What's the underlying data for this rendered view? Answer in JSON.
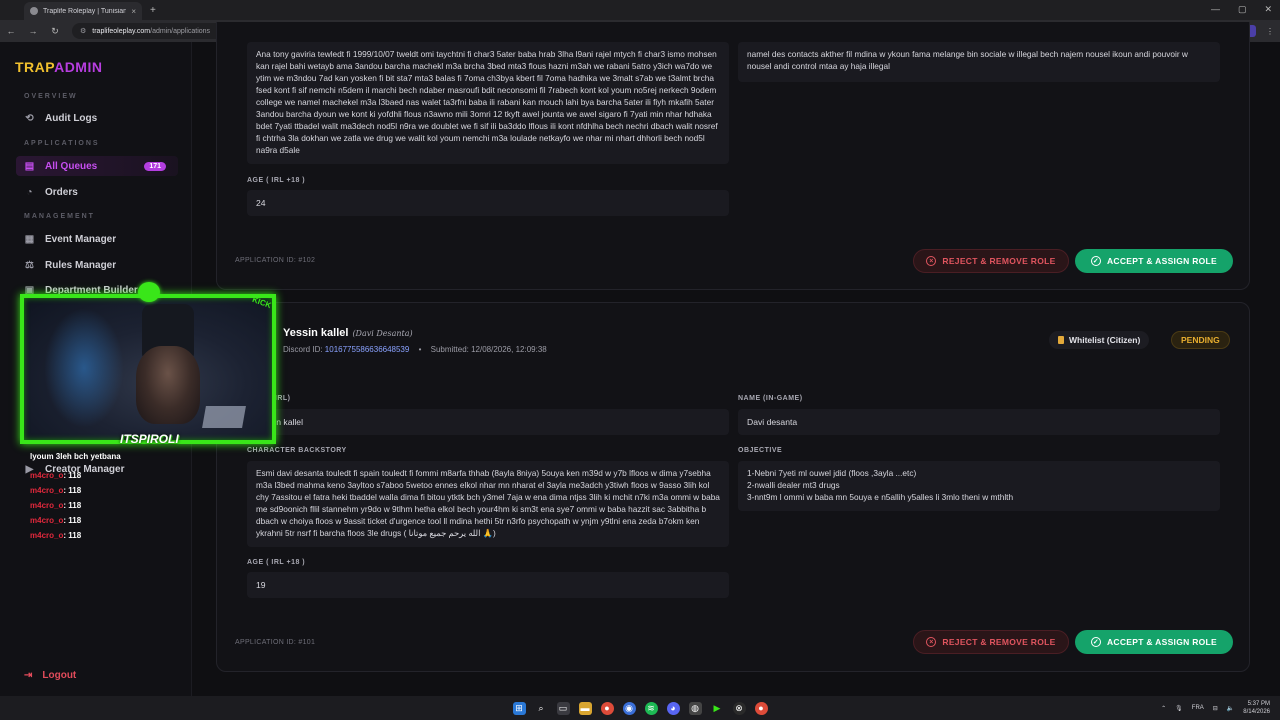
{
  "browser": {
    "tab_title": "Traplife Roleplay | Tunisian GTA",
    "url_host": "traplifeoleplay.com",
    "url_path": "/admin/applications",
    "new_tab": "+",
    "close": "×"
  },
  "sidebar": {
    "brand_1": "TRAP",
    "brand_2": "ADMIN",
    "sections": [
      "OVERVIEW",
      "APPLICATIONS",
      "MANAGEMENT"
    ],
    "items": [
      {
        "label": "Audit Logs",
        "icon": "history-icon"
      },
      {
        "label": "All Queues",
        "icon": "document-icon",
        "badge": "171"
      },
      {
        "label": "Orders",
        "icon": "tag-icon"
      },
      {
        "label": "Event Manager",
        "icon": "calendar-icon"
      },
      {
        "label": "Rules Manager",
        "icon": "scale-icon"
      },
      {
        "label": "Department Builder",
        "icon": "grid-icon"
      },
      {
        "label": "Creator Manager",
        "icon": "video-icon"
      }
    ],
    "logout": "Logout"
  },
  "overlay": {
    "streamer_tag": "ITSPIROLI",
    "kick": "KICK",
    "chat_first": "lyoum 3leh bch yetbana",
    "chat": [
      {
        "user": "m4cro_o",
        "msg": ": 118"
      },
      {
        "user": "m4cro_o",
        "msg": ": 118"
      },
      {
        "user": "m4cro_o",
        "msg": ": 118"
      },
      {
        "user": "m4cro_o",
        "msg": ": 118"
      },
      {
        "user": "m4cro_o",
        "msg": ": 118"
      }
    ]
  },
  "app1": {
    "backstory": "Ana tony gaviria tewledt fi 1999/10/07 tweldt omi taychtni fi char3 5ater baba hrab 3lha l9ani rajel mtych fi char3 ismo mohsen kan rajel bahi wetayb ama 3andou barcha machekl m3a brcha 3bed mta3 flous hazni m3ah we rabani 5atro y3ich wa7do we ytim we m3ndou 7ad kan yosken fi bit sta7 mta3 balas fi 7oma ch3bya kbert fil 7oma hadhika we 3malt s7ab we t3almt brcha fsed kont fi sif nemchi n5dem il marchi bech ndaber masroufi bdit neconsomi fil 7rabech kont kol youm no5rej nerkech 9odem college we namel machekel m3a l3baed nas walet ta3rfni baba ili rabani kan mouch lahi bya barcha 5ater ili fiyh mkafih 5ater 3andou barcha dyoun we kont ki yofdhli flous n3awno mili 3omri 12 tkyft awel jounta we awel sigaro fi 7yati min nhar hdhaka bdet 7yati ttbadel walit ma3dech nod5l n9ra we doublet we fi sif ili ba3ddo lflous ili kont nfdhlha bech nechri dbach walit nosref fi chtrha 3la dokhan we zatla we drug we walit kol youm nemchi m3a loulade netkayfo we nhar mi nhart dhhorli bech nod5l na9ra d5ale",
    "objective": "namel des contacts akther fil mdina w ykoun fama melange bin sociale w illegal bech najem nousel  ikoun andi pouvoir w  nousel andi control mtaa ay haja illegal",
    "age_label": "AGE ( IRL +18 )",
    "age": "24",
    "app_id": "APPLICATION ID: #102",
    "reject": "REJECT & REMOVE ROLE",
    "accept": "ACCEPT & ASSIGN ROLE"
  },
  "app2": {
    "name": "Yessin kallel",
    "rp_name": "(Davi Desanta)",
    "discord_label": "Discord ID: ",
    "discord_id": "1016775586636648539",
    "dot": "•",
    "submitted": "Submitted: 12/08/2026, 12:09:38",
    "type_tag": "Whitelist (Citizen)",
    "status": "PENDING",
    "name_irl_label": "NAME (IRL)",
    "name_irl": "Yessin kallel",
    "name_game_label": "NAME (IN-GAME)",
    "name_game": "Davi desanta",
    "backstory_label": "CHARACTER BACKSTORY",
    "backstory": "Esmi davi desanta touledt fi spain touledt fi fommi m8arfa thhab (8ayla 8niya) 5ouya ken m39d w y7b lfloos w dima y7sebha m3a l3bed mahma keno 3ayltoo s7aboo 5wetoo ennes elkol nhar mn nharat el 3ayla me3adch y3tiwh floos w 9asso 3lih kol chy 7assitou el fatra heki tbaddel walla dima fi bitou ytktk bch y3mel 7aja w ena dima ntjss 3lih ki mchit n7ki m3a ommi w baba me sd9oonich fllil  stannehm yr9do w 9tlhm hetha elkol bech your4hm ki sm3t ena sye7 ommi w baba hazzit sac 3abbitha b dbach w choiya floos  w 9assit ticket d'urgence tool ll mdina hethi 5tr n3rfo psychopath w ynjm y9tlni ena zeda b7okm ken ykrahni 5tr nsrf fi barcha floos 3le drugs  ( الله يرحم جميع موتانا 🙏)",
    "objective_label": "OBJECTIVE",
    "objective_lines": [
      "1-Nebni 7yeti ml ouwel jdid (floos ,3ayla ...etc)",
      "2-nwalli dealer mt3 drugs",
      "3-nnt9m l ommi w baba mn 5ouya e n5allih y5alles li 3mlo theni w mthlth"
    ],
    "age_label": "AGE ( IRL +18 )",
    "age": "19",
    "app_id": "APPLICATION ID: #101",
    "reject": "REJECT & REMOVE ROLE",
    "accept": "ACCEPT & ASSIGN ROLE"
  },
  "taskbar": {
    "lang": "FRA",
    "time": "5:37 PM",
    "date": "8/14/2026"
  },
  "colors": {
    "accent": "#b43ee0",
    "brand_gold": "#f2c12e",
    "accept": "#15a36a",
    "reject": "#e0555f",
    "pending": "#e6ad2f"
  }
}
